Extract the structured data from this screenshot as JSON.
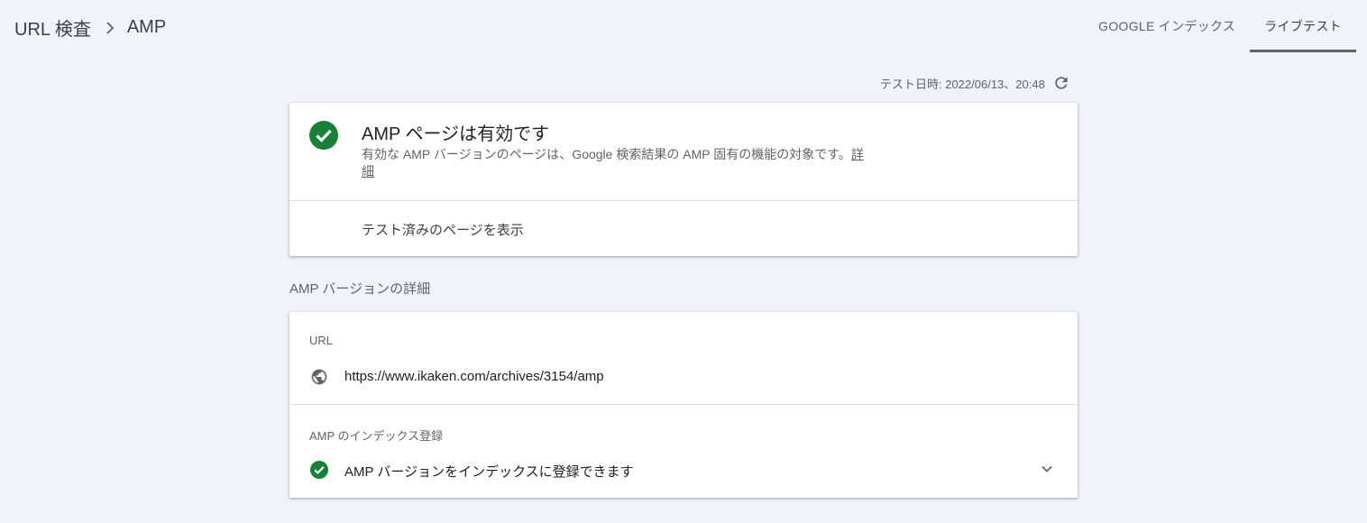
{
  "breadcrumb": {
    "parent": "URL 検査",
    "current": "AMP"
  },
  "tabs": [
    {
      "label": "GOOGLE インデックス"
    },
    {
      "label": "ライブテスト"
    }
  ],
  "test_date": "テスト日時: 2022/06/13、20:48",
  "status_card": {
    "title": "AMP ページは有効です",
    "description": "有効な AMP バージョンのページは、Google 検索結果の AMP 固有の機能の対象です。",
    "details_link": "詳細",
    "view_tested_page": "テスト済みのページを表示"
  },
  "details_section": {
    "title": "AMP バージョンの詳細",
    "url_label": "URL",
    "url_value": "https://www.ikaken.com/archives/3154/amp",
    "index_label": "AMP のインデックス登録",
    "index_value": "AMP バージョンをインデックスに登録できます"
  },
  "colors": {
    "success": "#188038",
    "accent": "#5f6368",
    "background": "#f0f4fa"
  },
  "icons": [
    "chevron-right-icon",
    "refresh-icon",
    "check-circle-icon",
    "globe-icon",
    "chevron-down-icon"
  ]
}
